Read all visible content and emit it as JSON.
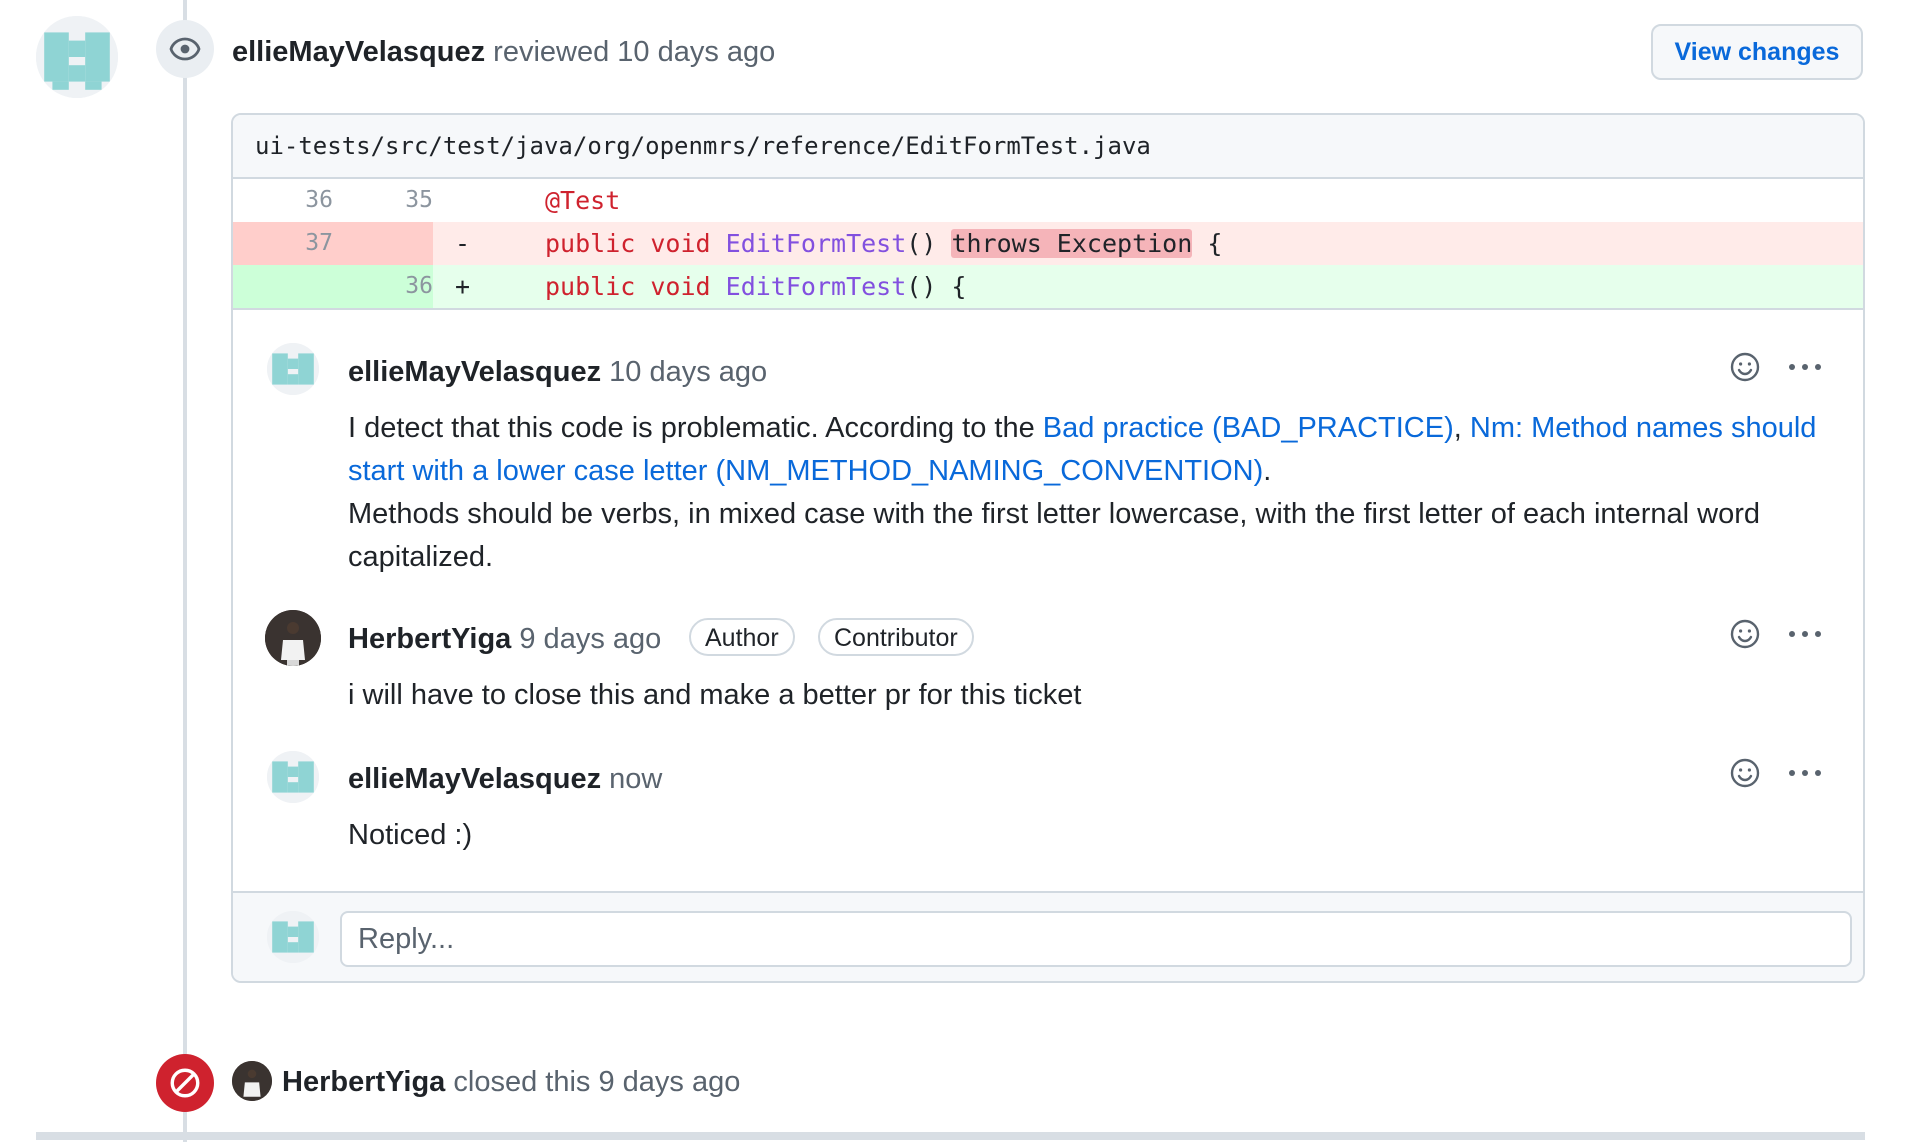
{
  "review_event": {
    "author": "ellieMayVelasquez",
    "action": "reviewed",
    "time": "10 days ago",
    "view_changes_label": "View changes"
  },
  "file": {
    "path": "ui-tests/src/test/java/org/openmrs/reference/EditFormTest.java"
  },
  "diff": {
    "rows": [
      {
        "type": "context",
        "old": "36",
        "new": "35",
        "marker": ""
      },
      {
        "type": "deletion",
        "old": "37",
        "new": "",
        "marker": "-"
      },
      {
        "type": "addition",
        "old": "",
        "new": "36",
        "marker": "+"
      }
    ],
    "context_line": "@Test",
    "del_kw1": "public",
    "del_kw2": "void",
    "del_fn": "EditFormTest",
    "del_parens": "()",
    "del_removed": "throws Exception",
    "del_brace": "{",
    "add_kw1": "public",
    "add_kw2": "void",
    "add_fn": "EditFormTest",
    "add_rest": "() {"
  },
  "comments": [
    {
      "author": "ellieMayVelasquez",
      "time": "10 days ago",
      "body_intro": "I detect that this code is problematic. According to the",
      "link1": "Bad practice (BAD_PRACTICE)",
      "sep": ",",
      "link2a": "Nm: Method names should",
      "link2b": "start with a lower case letter (NM_METHOD_NAMING_CONVENTION)",
      "period": ".",
      "body_line3": "Methods should be verbs, in mixed case with the first letter lowercase, with the first letter of each internal word",
      "body_line4": "capitalized."
    },
    {
      "author": "HerbertYiga",
      "time": "9 days ago",
      "labels": [
        "Author",
        "Contributor"
      ],
      "body": "i will have to close this and make a better pr for this ticket"
    },
    {
      "author": "ellieMayVelasquez",
      "time": "now",
      "body": "Noticed :)"
    }
  ],
  "reply": {
    "placeholder": "Reply..."
  },
  "closed_event": {
    "author": "HerbertYiga",
    "action": "closed this",
    "time": "9 days ago"
  },
  "colors": {
    "link": "#0969da",
    "deletion_bg": "#ffebe9",
    "addition_bg": "#e6ffec",
    "closed_badge": "#cf222e"
  }
}
